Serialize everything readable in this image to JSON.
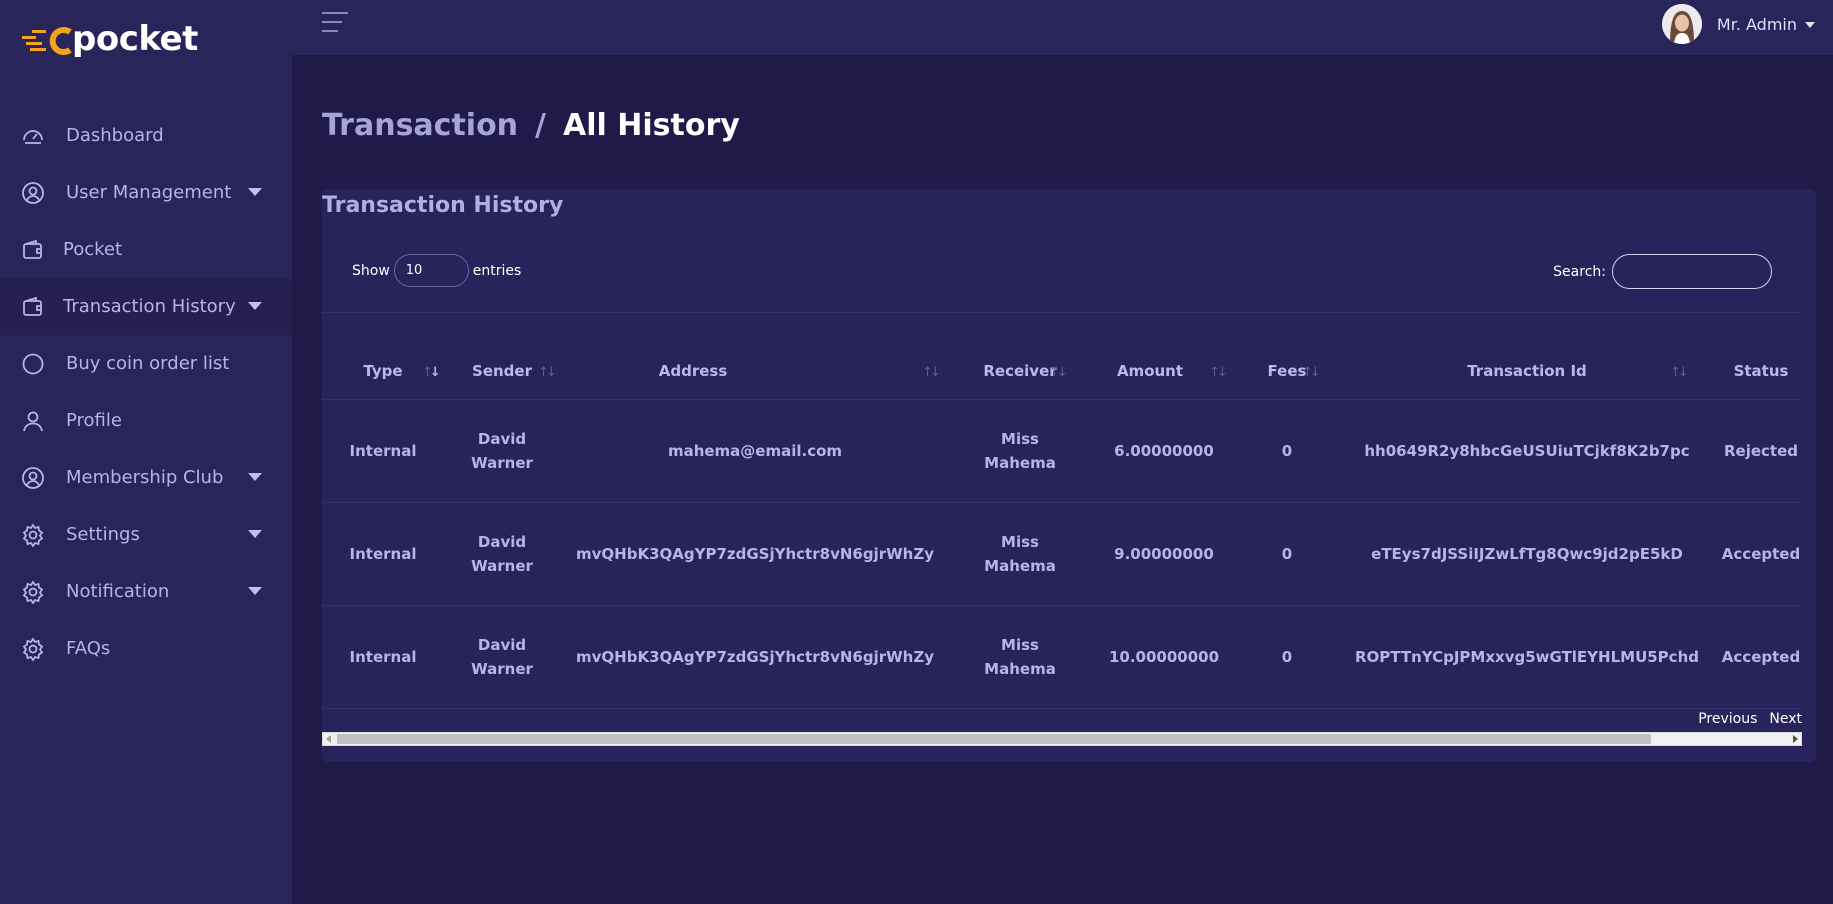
{
  "app": {
    "logo_text": "pocket"
  },
  "sidebar": {
    "items": [
      {
        "label": "Dashboard",
        "icon": "gauge-icon",
        "has_submenu": false
      },
      {
        "label": "User Management",
        "icon": "user-circle-icon",
        "has_submenu": true
      },
      {
        "label": "Pocket",
        "icon": "wallet-icon",
        "has_submenu": false
      },
      {
        "label": "Transaction History",
        "icon": "wallet-icon",
        "has_submenu": true,
        "active": true
      },
      {
        "label": "Buy coin order list",
        "icon": "circle-icon",
        "has_submenu": false
      },
      {
        "label": "Profile",
        "icon": "user-icon",
        "has_submenu": false
      },
      {
        "label": "Membership Club",
        "icon": "user-circle-icon",
        "has_submenu": true
      },
      {
        "label": "Settings",
        "icon": "gear-icon",
        "has_submenu": true
      },
      {
        "label": "Notification",
        "icon": "gear-icon",
        "has_submenu": true
      },
      {
        "label": "FAQs",
        "icon": "gear-icon",
        "has_submenu": false
      }
    ]
  },
  "topbar": {
    "user_name": "Mr. Admin"
  },
  "breadcrumb": {
    "parent": "Transaction",
    "separator": "/",
    "current": "All History"
  },
  "card": {
    "title": "Transaction History",
    "show_label": "Show",
    "entries_value": "10",
    "entries_label": "entries",
    "search_label": "Search:",
    "search_value": ""
  },
  "table": {
    "columns": [
      "Type",
      "Sender",
      "Address",
      "Receiver",
      "Amount",
      "Fees",
      "Transaction Id",
      "Status"
    ],
    "rows": [
      {
        "type": "Internal",
        "sender_first": "David",
        "sender_last": "Warner",
        "address": "mahema@email.com",
        "receiver_first": "Miss",
        "receiver_last": "Mahema",
        "amount": "6.00000000",
        "fees": "0",
        "transaction_id": "hh0649R2y8hbcGeUSUiuTCjkf8K2b7pc",
        "status": "Rejected"
      },
      {
        "type": "Internal",
        "sender_first": "David",
        "sender_last": "Warner",
        "address": "mvQHbK3QAgYP7zdGSjYhctr8vN6gjrWhZy",
        "receiver_first": "Miss",
        "receiver_last": "Mahema",
        "amount": "9.00000000",
        "fees": "0",
        "transaction_id": "eTEys7dJSSiIJZwLfTg8Qwc9jd2pE5kD",
        "status": "Accepted"
      },
      {
        "type": "Internal",
        "sender_first": "David",
        "sender_last": "Warner",
        "address": "mvQHbK3QAgYP7zdGSjYhctr8vN6gjrWhZy",
        "receiver_first": "Miss",
        "receiver_last": "Mahema",
        "amount": "10.00000000",
        "fees": "0",
        "transaction_id": "ROPTTnYCpJPMxxvg5wGTlEYHLMU5Pchd",
        "status": "Accepted"
      }
    ]
  },
  "pagination": {
    "previous": "Previous",
    "next": "Next"
  },
  "colors": {
    "sidebar_bg": "#29245a",
    "page_bg": "#1f1a47",
    "accent": "#f4a11d"
  }
}
